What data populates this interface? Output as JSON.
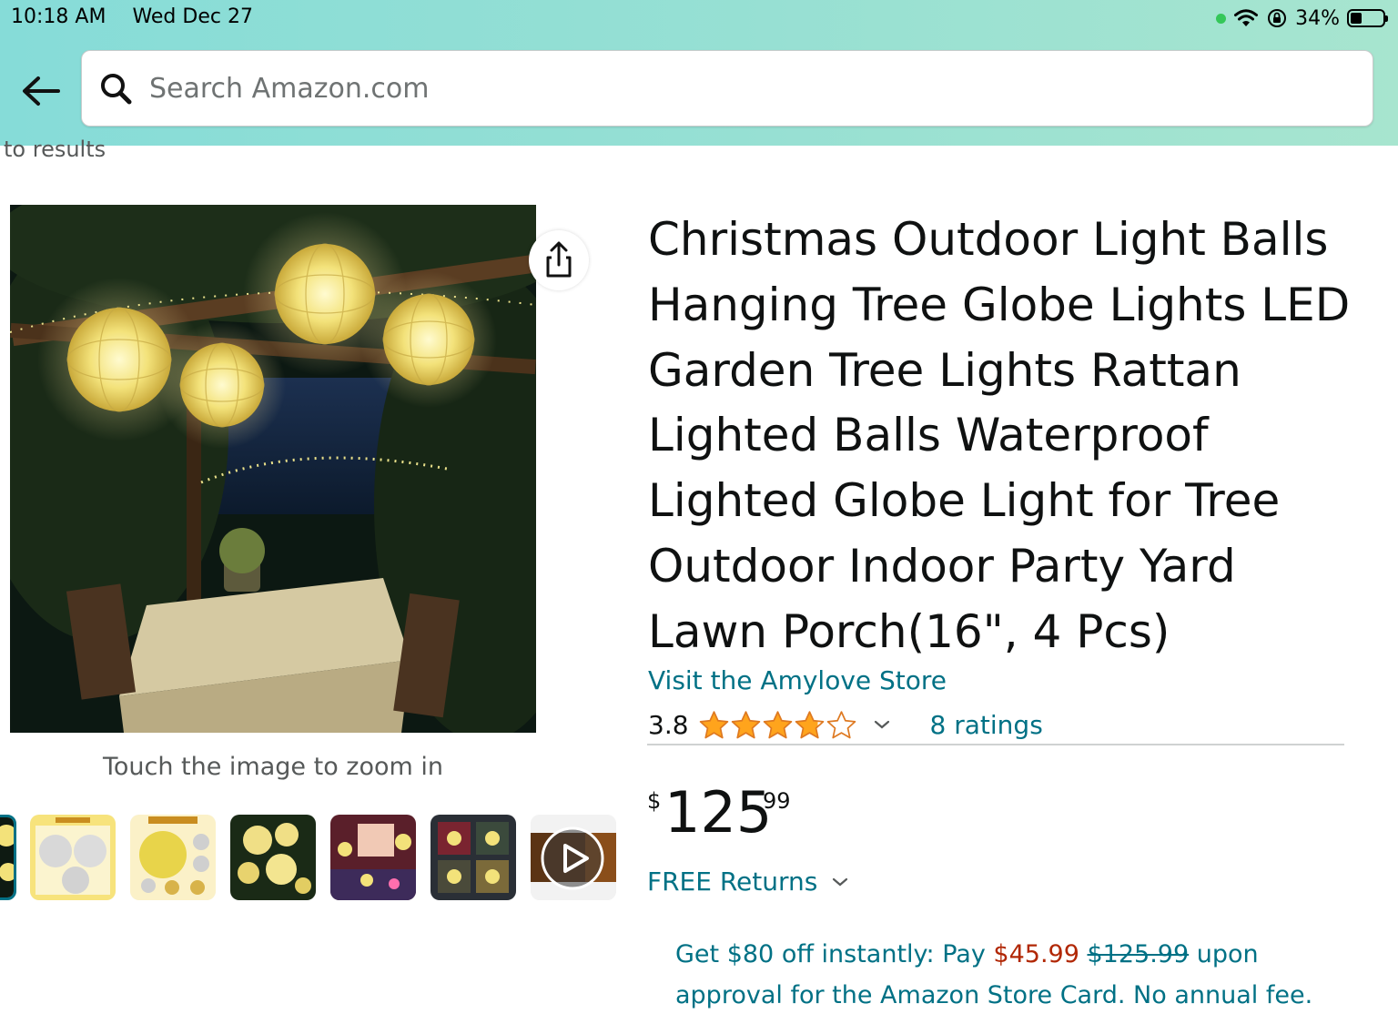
{
  "status_bar": {
    "time": "10:18 AM",
    "date": "Wed Dec 27",
    "battery": "34%",
    "battery_level": 0.34
  },
  "search": {
    "placeholder": "Search Amazon.com"
  },
  "back_results": "to results",
  "product": {
    "zoom_hint": "Touch the image to zoom in",
    "title": "Christmas Outdoor Light Balls Hanging Tree Globe Lights LED Garden Tree Lights Rattan Lighted Balls Waterproof Lighted Globe Light for Tree Outdoor Indoor Party Yard Lawn Porch(16\", 4 Pcs)",
    "store": "Visit the Amylove Store",
    "rating": "3.8",
    "rating_value": 3.8,
    "ratings_count": "8 ratings",
    "price": {
      "symbol": "$",
      "whole": "125",
      "fraction": "99"
    },
    "free_returns": "FREE Returns",
    "promo": {
      "prefix": "Get $80 off instantly: Pay ",
      "new_price": "$45.99",
      "old_price": "$125.99",
      "suffix": " upon approval for the Amazon Store Card. No annual fee."
    }
  },
  "colors": {
    "link": "#007185",
    "sale": "#b12704",
    "star": "#ffa41c",
    "header": "#8fded6"
  }
}
